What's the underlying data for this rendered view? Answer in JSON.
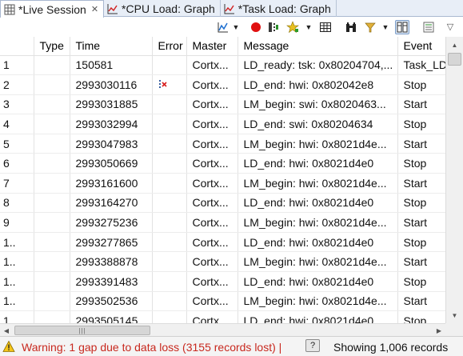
{
  "tabs": [
    {
      "label": "*Live Session",
      "icon": "table-icon",
      "active": true,
      "closable": true
    },
    {
      "label": "*CPU Load: Graph",
      "icon": "graph-icon",
      "active": false,
      "closable": false
    },
    {
      "label": "*Task Load: Graph",
      "icon": "graph-icon",
      "active": false,
      "closable": false
    }
  ],
  "toolbar": {
    "icons": [
      "analysis-icon",
      "dropdown-arrow-icon",
      "record-icon",
      "stream-icon",
      "star-icon",
      "dropdown-arrow-icon",
      "grid-icon",
      "binoculars-icon",
      "filter-icon",
      "dropdown-arrow-icon",
      "group-icon",
      "view-menu-icon",
      "chevron-down-icon"
    ]
  },
  "table": {
    "columns": [
      "",
      "Type",
      "Time",
      "Error",
      "Master",
      "Message",
      "Event"
    ],
    "rows": [
      {
        "index": "1",
        "type": "",
        "time": "150581",
        "error": "",
        "master": "Cortx...",
        "message": "LD_ready: tsk: 0x80204704,...",
        "event": "Task_LD"
      },
      {
        "index": "2",
        "type": "",
        "time": "2993030116",
        "error": "x",
        "master": "Cortx...",
        "message": "LD_end: hwi: 0x802042e8",
        "event": "Stop"
      },
      {
        "index": "3",
        "type": "",
        "time": "2993031885",
        "error": "",
        "master": "Cortx...",
        "message": "LM_begin: swi: 0x8020463...",
        "event": "Start"
      },
      {
        "index": "4",
        "type": "",
        "time": "2993032994",
        "error": "",
        "master": "Cortx...",
        "message": "LD_end: swi: 0x80204634",
        "event": "Stop"
      },
      {
        "index": "5",
        "type": "",
        "time": "2993047983",
        "error": "",
        "master": "Cortx...",
        "message": "LM_begin: hwi: 0x8021d4e...",
        "event": "Start"
      },
      {
        "index": "6",
        "type": "",
        "time": "2993050669",
        "error": "",
        "master": "Cortx...",
        "message": "LD_end: hwi: 0x8021d4e0",
        "event": "Stop"
      },
      {
        "index": "7",
        "type": "",
        "time": "2993161600",
        "error": "",
        "master": "Cortx...",
        "message": "LM_begin: hwi: 0x8021d4e...",
        "event": "Start"
      },
      {
        "index": "8",
        "type": "",
        "time": "2993164270",
        "error": "",
        "master": "Cortx...",
        "message": "LD_end: hwi: 0x8021d4e0",
        "event": "Stop"
      },
      {
        "index": "9",
        "type": "",
        "time": "2993275236",
        "error": "",
        "master": "Cortx...",
        "message": "LM_begin: hwi: 0x8021d4e...",
        "event": "Start"
      },
      {
        "index": "1..",
        "type": "",
        "time": "2993277865",
        "error": "",
        "master": "Cortx...",
        "message": "LD_end: hwi: 0x8021d4e0",
        "event": "Stop"
      },
      {
        "index": "1..",
        "type": "",
        "time": "2993388878",
        "error": "",
        "master": "Cortx...",
        "message": "LM_begin: hwi: 0x8021d4e...",
        "event": "Start"
      },
      {
        "index": "1..",
        "type": "",
        "time": "2993391483",
        "error": "",
        "master": "Cortx...",
        "message": "LD_end: hwi: 0x8021d4e0",
        "event": "Stop"
      },
      {
        "index": "1..",
        "type": "",
        "time": "2993502536",
        "error": "",
        "master": "Cortx...",
        "message": "LM_begin: hwi: 0x8021d4e...",
        "event": "Start"
      },
      {
        "index": "1..",
        "type": "",
        "time": "2993505145",
        "error": "",
        "master": "Cortx...",
        "message": "LD_end: hwi: 0x8021d4e0",
        "event": "Stop"
      }
    ]
  },
  "status": {
    "warning": "Warning: 1 gap due to data loss (3155 records lost) |",
    "help_label": "?",
    "count": "Showing 1,006 records"
  },
  "colors": {
    "warning_text": "#c8281e",
    "tab_bar": "#e8eef7",
    "record_button": "#e01010"
  }
}
